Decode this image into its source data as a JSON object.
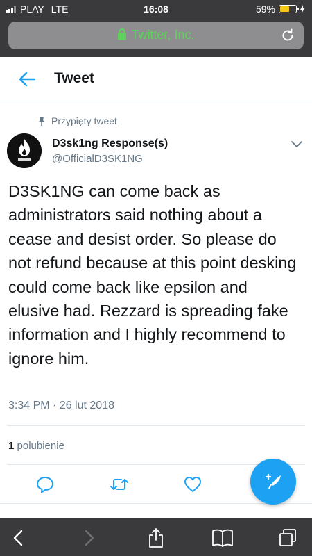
{
  "status_bar": {
    "carrier": "PLAY",
    "network": "LTE",
    "time": "16:08",
    "battery_percent_label": "59%",
    "battery_level": 0.59
  },
  "address_bar": {
    "site": "Twitter, Inc."
  },
  "header": {
    "title": "Tweet"
  },
  "tweet": {
    "pinned_label": "Przypięty tweet",
    "display_name": "D3sk1ng Response(s)",
    "handle": "@OfficialD3SK1NG",
    "text": "D3SK1NG can come back as administrators said nothing about a cease and desist order. So please do not refund because at this point desking could come back like epsilon and elusive had. Rezzard is spreading fake information and I highly recommend to ignore him.",
    "timestamp": "3:34 PM · 26 lut 2018",
    "likes_count": "1",
    "likes_label": "polubienie"
  },
  "colors": {
    "twitter_blue": "#1da1f2",
    "secure_green": "#5fd25b",
    "muted_text": "#657786"
  },
  "icons": {
    "back": "arrow-left-icon",
    "pin": "pin-icon",
    "chevron": "chevron-down-icon",
    "reply": "reply-icon",
    "retweet": "retweet-icon",
    "like": "heart-icon",
    "compose": "compose-tweet-icon"
  }
}
